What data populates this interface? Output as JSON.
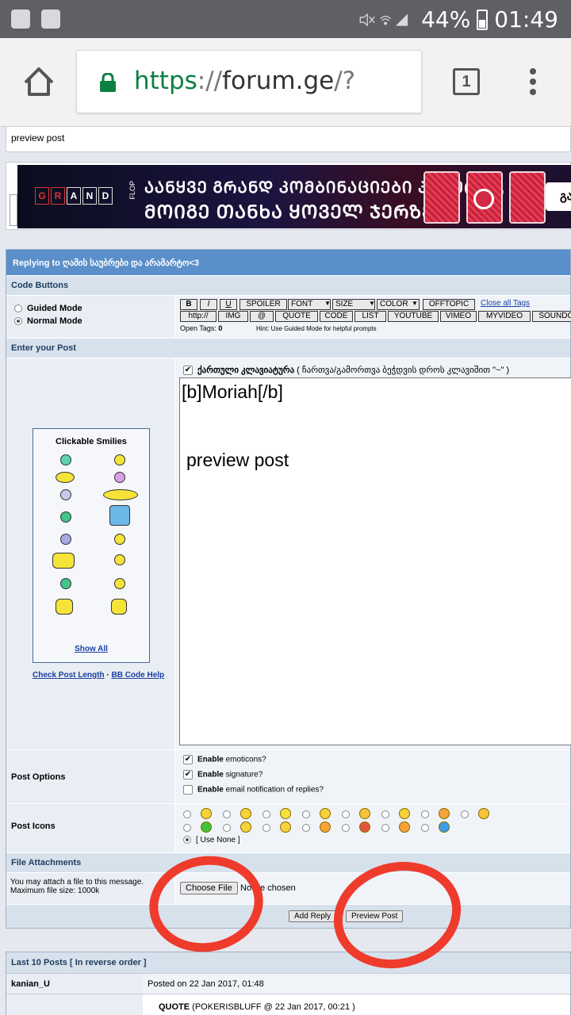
{
  "status": {
    "battery": "44%",
    "time": "01:49"
  },
  "browser": {
    "url_scheme": "https",
    "url_sep": "://",
    "url_host": "forum.ge",
    "url_path": "/?",
    "tab_count": "1"
  },
  "page": {
    "breadcrumb": "preview post"
  },
  "banner": {
    "letters": [
      "G",
      "R",
      "A",
      "N",
      "D"
    ],
    "flop": "FLOP",
    "line1": "ᲐᲐᲜᲧᲕᲔ ᲒᲠᲐᲜᲓ ᲙᲝᲛᲑᲘᲜᲐᲪᲘᲔᲑᲘ ᲞᲝᲙᲔᲠᲨᲘ,",
    "line2": "ᲛᲝᲘᲒᲔ ᲗᲐᲜᲮᲐ ᲧᲝᲕᲔᲚ ᲯᲔᲠᲖᲔ!",
    "button": "გა"
  },
  "form": {
    "title": "Replying to ღამის საუბრები და არამარტო<3",
    "code_buttons_label": "Code Buttons",
    "guided_mode": "Guided Mode",
    "normal_mode": "Normal Mode",
    "buttons_row1": [
      "B",
      "I",
      "U",
      "SPOILER",
      "FONT",
      "SIZE",
      "COLOR",
      "OFFTOPIC"
    ],
    "close_all": "Close all Tags",
    "buttons_row2": [
      "http://",
      "IMG",
      "@",
      "QUOTE",
      "CODE",
      "LIST",
      "YOUTUBE",
      "VIMEO",
      "MYVIDEO",
      "SOUNDC"
    ],
    "open_tags_label": "Open Tags:",
    "open_tags_count": "0",
    "hint": "Hint: Use Guided Mode for helpful prompts",
    "enter_post_label": "Enter your Post",
    "georgian_kb_label": "ქართული კლავიატურა",
    "georgian_kb_hint": "( ჩართვა/გამორთვა ბეჭდვის დროს კლავიშით \"~\" )",
    "post_line1": "[b]Moriah[/b]",
    "post_line2": "preview post",
    "smilies_title": "Clickable Smilies",
    "show_all": "Show All",
    "check_length": "Check Post Length",
    "separator": " · ",
    "bb_help": "BB Code Help",
    "post_options_label": "Post Options",
    "opt_enable": "Enable",
    "opt1": " emoticons?",
    "opt2": " signature?",
    "opt3": " email notification of replies?",
    "post_icons_label": "Post Icons",
    "use_none": "[ Use None ]",
    "attachments_label": "File Attachments",
    "attach_info1": "You may attach a file to this message.",
    "attach_info2": "Maximum file size: 1000k",
    "choose_file": "Choose File",
    "no_file": "No file chosen",
    "add_reply": "Add Reply",
    "preview_post": "Preview Post"
  },
  "last_posts": {
    "header": "Last 10 Posts [ In reverse order ]",
    "user": "kanian_U",
    "posted": "Posted on 22 Jan 2017, 01:48",
    "quote_label": "QUOTE",
    "quote_meta": " (POKERISBLUFF @ 22 Jan 2017, 00:21 )"
  },
  "colors": {
    "accent": "#5b8fca",
    "annotation": "#ee3b2c",
    "secure": "#0b8043"
  }
}
